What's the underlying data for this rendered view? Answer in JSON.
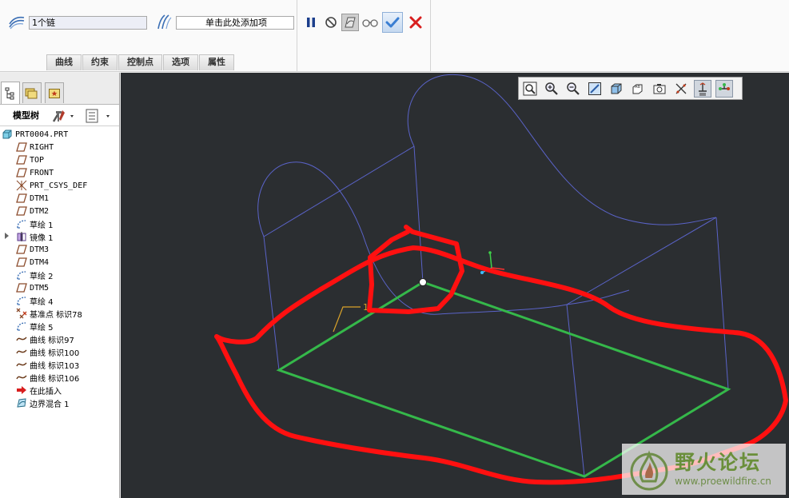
{
  "dashboard": {
    "chain_field_value": "1个链",
    "add_item_placeholder": "单击此处添加项",
    "tabs": [
      "曲线",
      "约束",
      "控制点",
      "选项",
      "属性"
    ]
  },
  "model_tree": {
    "title": "模型树",
    "items": [
      {
        "label": "PRT0004.PRT",
        "icon": "part-icon",
        "mono": true
      },
      {
        "label": "RIGHT",
        "icon": "datum-plane-icon",
        "mono": true
      },
      {
        "label": "TOP",
        "icon": "datum-plane-icon",
        "mono": true
      },
      {
        "label": "FRONT",
        "icon": "datum-plane-icon",
        "mono": true
      },
      {
        "label": "PRT_CSYS_DEF",
        "icon": "coordinate-system-icon",
        "mono": true
      },
      {
        "label": "DTM1",
        "icon": "datum-plane-icon",
        "mono": true
      },
      {
        "label": "DTM2",
        "icon": "datum-plane-icon",
        "mono": true
      },
      {
        "label": "草绘 1",
        "icon": "sketch-icon",
        "mono": false
      },
      {
        "label": "镜像 1",
        "icon": "mirror-icon",
        "mono": false,
        "expandable": true
      },
      {
        "label": "DTM3",
        "icon": "datum-plane-icon",
        "mono": true
      },
      {
        "label": "DTM4",
        "icon": "datum-plane-icon",
        "mono": true
      },
      {
        "label": "草绘 2",
        "icon": "sketch-icon",
        "mono": false
      },
      {
        "label": "DTM5",
        "icon": "datum-plane-icon",
        "mono": true
      },
      {
        "label": "草绘 4",
        "icon": "sketch-icon",
        "mono": false
      },
      {
        "label": "基准点 标识78",
        "icon": "datum-point-icon",
        "mono": false
      },
      {
        "label": "草绘 5",
        "icon": "sketch-icon",
        "mono": false
      },
      {
        "label": "曲线 标识97",
        "icon": "curve-icon",
        "mono": false
      },
      {
        "label": "曲线 标识100",
        "icon": "curve-icon",
        "mono": false
      },
      {
        "label": "曲线 标识103",
        "icon": "curve-icon",
        "mono": false
      },
      {
        "label": "曲线 标识106",
        "icon": "curve-icon",
        "mono": false
      },
      {
        "label": "在此插入",
        "icon": "insert-here-arrow-icon",
        "mono": false
      },
      {
        "label": "边界混合 1",
        "icon": "boundary-blend-icon",
        "mono": false
      }
    ]
  },
  "graphics": {
    "dimension_label": "1",
    "watermark_cn": "野火论坛",
    "watermark_url": "www.proewildfire.cn"
  },
  "colors": {
    "background": "#2b2e31",
    "wireframe": "#5a63c8",
    "selected_chain": "#35b84a",
    "annotation": "#ff1010",
    "confirm": "#4a8cd8",
    "cancel": "#d81e1e"
  }
}
